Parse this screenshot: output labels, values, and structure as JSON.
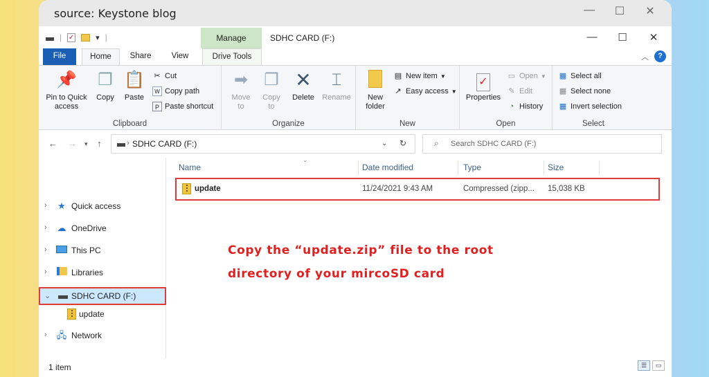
{
  "source_label": "source: Keystone blog",
  "outer_controls": {
    "minimize": "—",
    "maximize": "☐",
    "close": "✕"
  },
  "window": {
    "title": "SDHC CARD (F:)",
    "manage_label": "Manage",
    "controls": {
      "minimize": "—",
      "maximize": "☐",
      "close": "✕"
    }
  },
  "tabs": {
    "file": "File",
    "home": "Home",
    "share": "Share",
    "view": "View",
    "drive_tools": "Drive Tools",
    "help": "?"
  },
  "ribbon": {
    "clipboard": {
      "label": "Clipboard",
      "pin": "Pin to Quick\naccess",
      "copy": "Copy",
      "paste": "Paste",
      "cut": "Cut",
      "copy_path": "Copy path",
      "paste_shortcut": "Paste shortcut"
    },
    "organize": {
      "label": "Organize",
      "move_to": "Move\nto",
      "copy_to": "Copy\nto",
      "delete": "Delete",
      "rename": "Rename"
    },
    "new": {
      "label": "New",
      "new_folder": "New\nfolder",
      "new_item": "New item",
      "easy_access": "Easy access"
    },
    "open": {
      "label": "Open",
      "properties": "Properties",
      "open": "Open",
      "edit": "Edit",
      "history": "History"
    },
    "select": {
      "label": "Select",
      "select_all": "Select all",
      "select_none": "Select none",
      "invert_selection": "Invert selection"
    }
  },
  "address": {
    "path": "SDHC CARD (F:)",
    "search_placeholder": "Search SDHC CARD (F:)"
  },
  "nav_pane": [
    {
      "label": "Quick access",
      "icon": "star-icon",
      "expanded": false
    },
    {
      "label": "OneDrive",
      "icon": "cloud-icon",
      "expanded": false
    },
    {
      "label": "This PC",
      "icon": "monitor-icon",
      "expanded": false
    },
    {
      "label": "Libraries",
      "icon": "library-icon",
      "expanded": false
    },
    {
      "label": "SDHC CARD (F:)",
      "icon": "drive-icon",
      "expanded": true,
      "selected": true
    },
    {
      "label": "update",
      "icon": "zip-folder-icon",
      "child": true
    },
    {
      "label": "Network",
      "icon": "network-icon",
      "expanded": false
    }
  ],
  "columns": {
    "name": "Name",
    "date": "Date modified",
    "type": "Type",
    "size": "Size"
  },
  "files": [
    {
      "name": "update",
      "date": "11/24/2021 9:43 AM",
      "type": "Compressed (zipp...",
      "size": "15,038 KB"
    }
  ],
  "annotation": {
    "line1": "Copy the “update.zip” file to the root",
    "line2": "directory of your mircoSD card"
  },
  "status": {
    "item_count": "1 item"
  },
  "colors": {
    "highlight": "#e03a3a",
    "accent": "#1a5fb4",
    "manage": "#cde6c7"
  }
}
